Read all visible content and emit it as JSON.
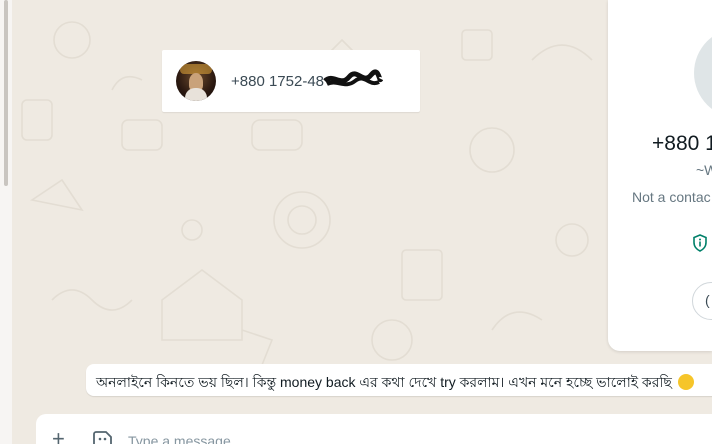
{
  "contact_card": {
    "number": "+880 1752-48"
  },
  "info_panel": {
    "number": "+880 1",
    "name": "~W",
    "not_contact": "Not a contac",
    "button_glyph": "("
  },
  "message": {
    "text": "অনলাইনে কিনতে ভয় ছিল। কিন্তু money back এর কথা দেখে try করলাম। এখন মনে হচ্ছে ভালোই করছি"
  },
  "composer": {
    "plus": "+",
    "placeholder": "Type a message"
  },
  "colors": {
    "chat_bg": "#efeae2",
    "icon": "#54656f",
    "shield": "#008069"
  },
  "icons": [
    "plus-icon",
    "sticker-icon",
    "shield-icon",
    "emoji-icon"
  ]
}
